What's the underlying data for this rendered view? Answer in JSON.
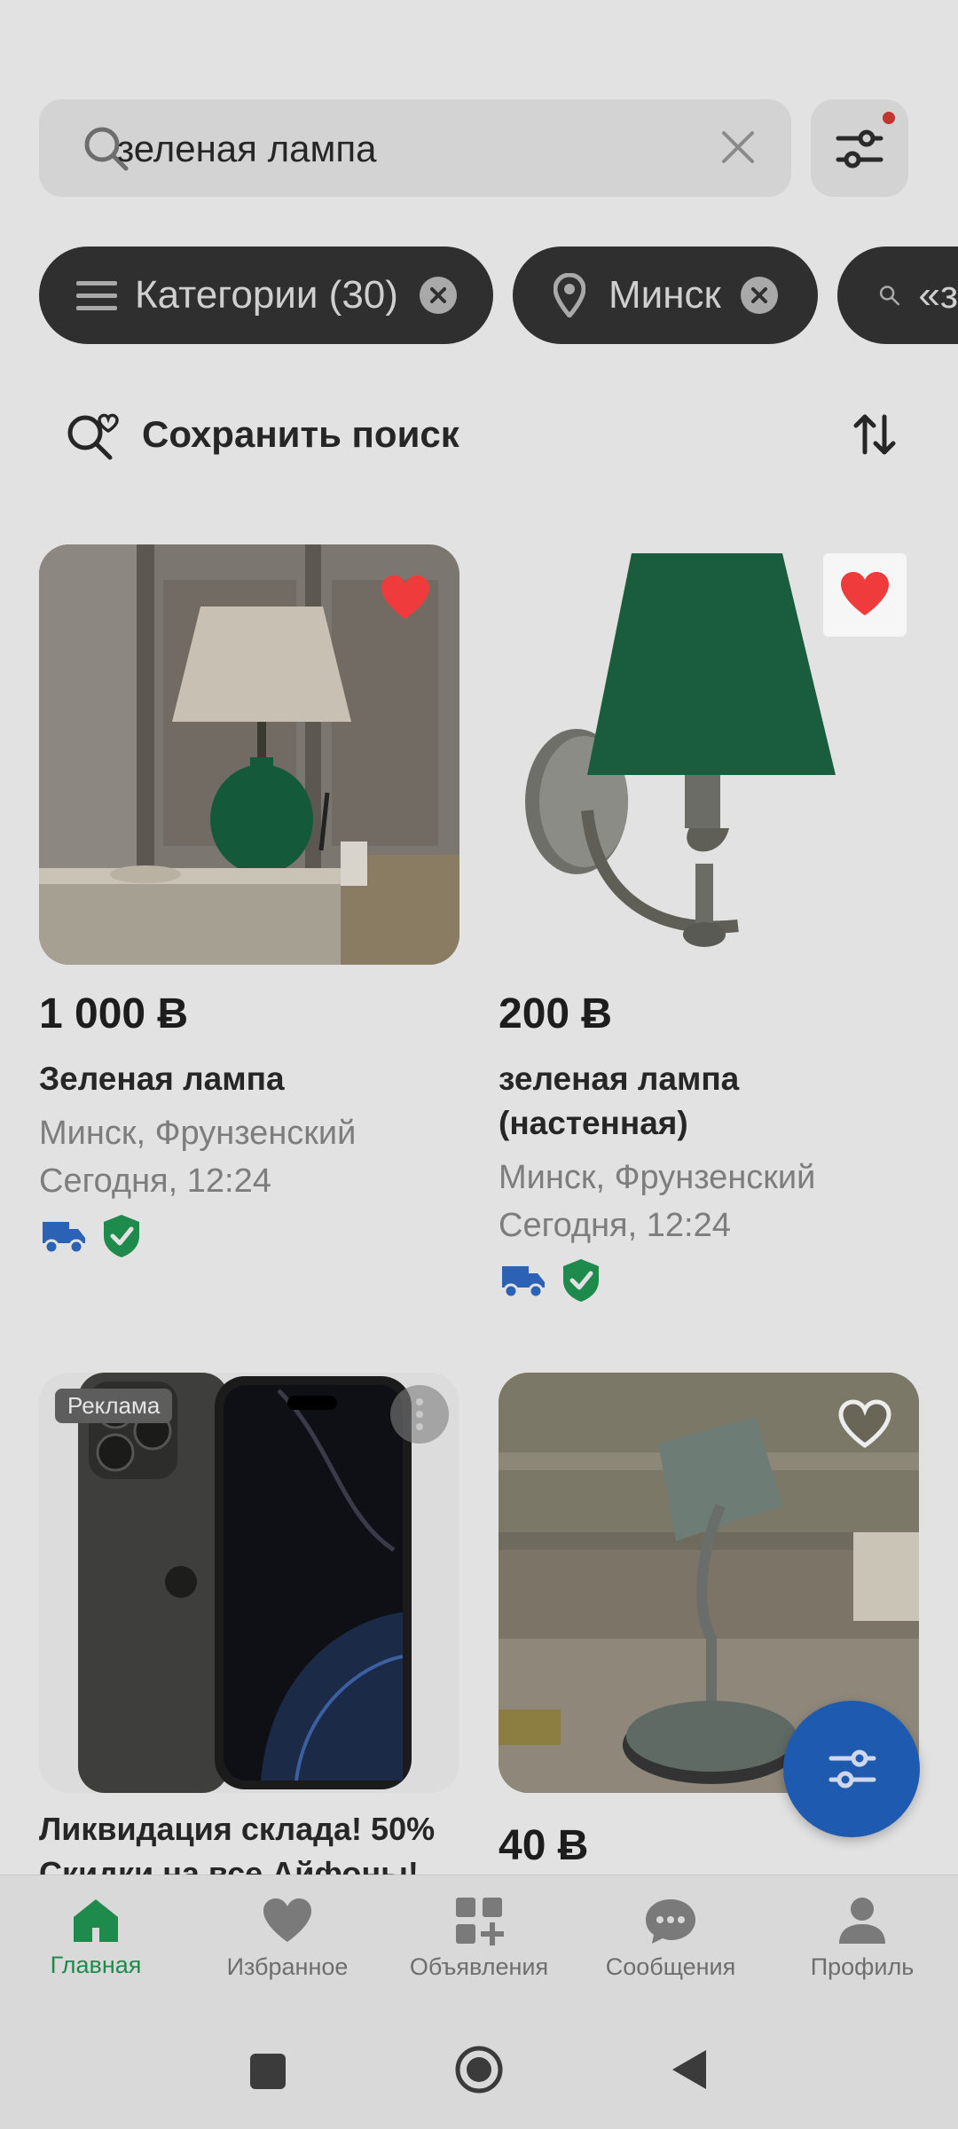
{
  "search": {
    "query": "зеленая лампа"
  },
  "chips": [
    {
      "label": "Категории (30)"
    },
    {
      "label": "Минск"
    },
    {
      "label": "«з"
    }
  ],
  "save_search_label": "Сохранить поиск",
  "listings": [
    {
      "price": "1 000 Ƀ",
      "title": "Зеленая лампа",
      "location": "Минск, Фрунзенский",
      "time": "Сегодня, 12:24",
      "favorited": true
    },
    {
      "price": "200 Ƀ",
      "title_line1": "зеленая лампа",
      "title_line2": "(настенная)",
      "location": "Минск, Фрунзенский",
      "time": "Сегодня, 12:24",
      "favorited": true
    },
    {
      "badge": "Реклама",
      "title_line1": "Ликвидация склада! 50%",
      "title_line2": "Скидки на все Айфоны!"
    },
    {
      "price": "40 Ƀ",
      "favorited": false
    }
  ],
  "nav": [
    {
      "label": "Главная",
      "icon": "home-icon",
      "active": true
    },
    {
      "label": "Избранное",
      "icon": "heart-icon"
    },
    {
      "label": "Объявления",
      "icon": "add-grid-icon"
    },
    {
      "label": "Сообщения",
      "icon": "chat-icon"
    },
    {
      "label": "Профиль",
      "icon": "person-icon"
    }
  ],
  "colors": {
    "accent_green": "#1e8a4c",
    "fab_blue": "#1e5bb0",
    "heart_red": "#ef3b3b",
    "delivery_blue": "#2b62b5"
  }
}
